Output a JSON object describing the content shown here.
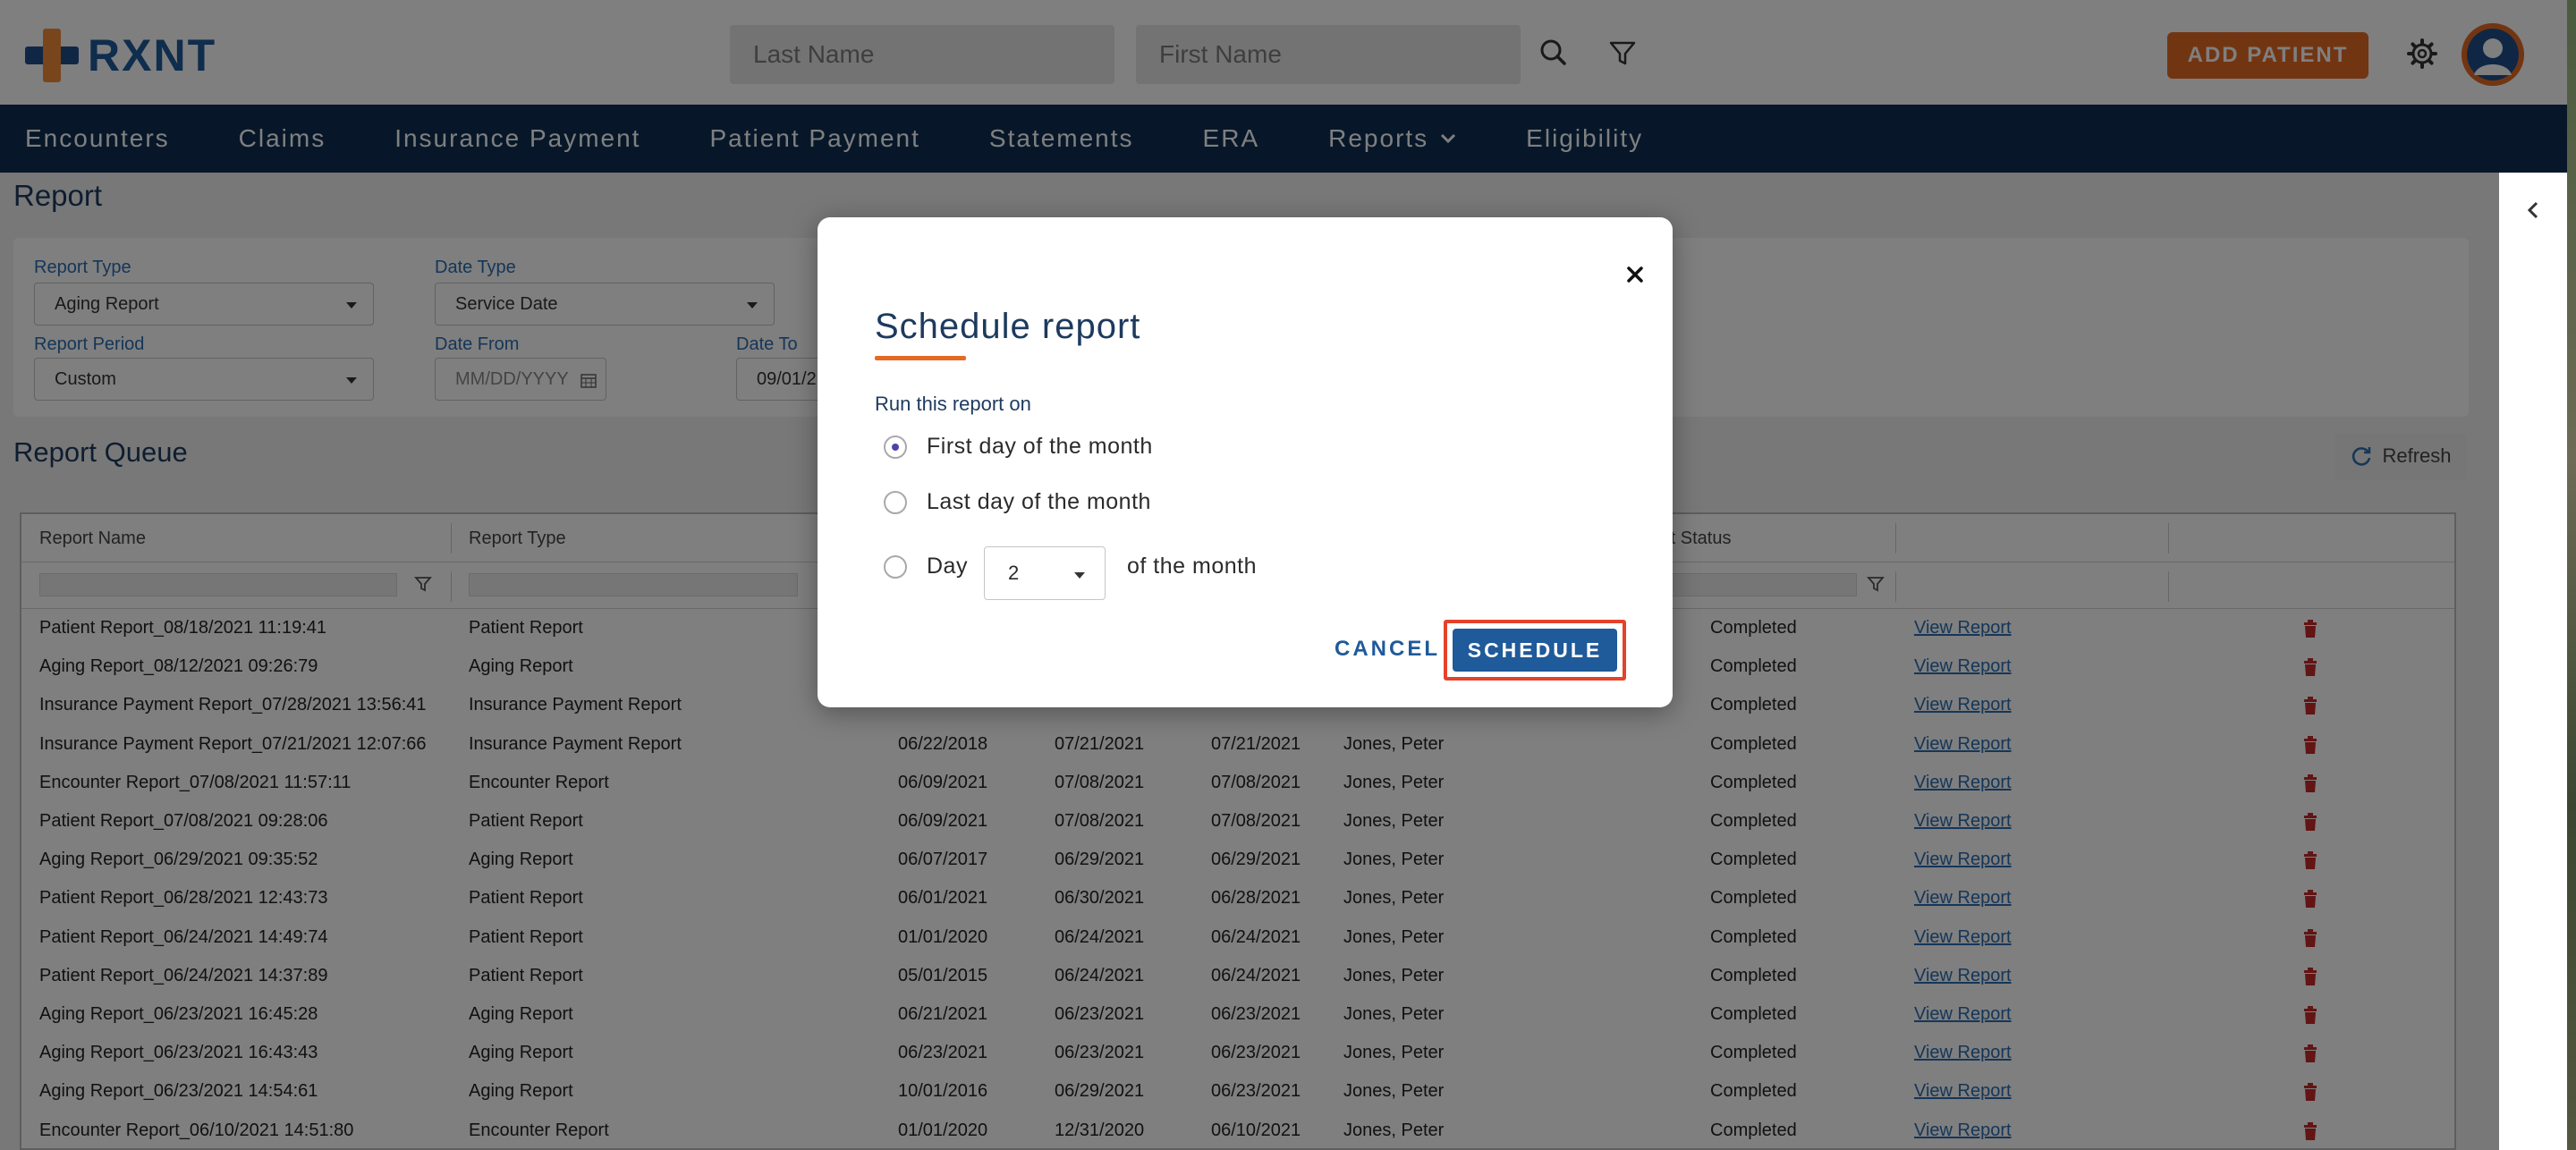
{
  "app": {
    "logo_text": "RXNT"
  },
  "header": {
    "last_name_placeholder": "Last Name",
    "first_name_placeholder": "First Name",
    "add_patient_label": "ADD PATIENT"
  },
  "nav": {
    "items": [
      {
        "label": "Encounters"
      },
      {
        "label": "Claims"
      },
      {
        "label": "Insurance Payment"
      },
      {
        "label": "Patient Payment"
      },
      {
        "label": "Statements"
      },
      {
        "label": "ERA"
      },
      {
        "label": "Reports"
      },
      {
        "label": "Eligibility"
      }
    ]
  },
  "page": {
    "title": "Report",
    "queue_title": "Report Queue",
    "refresh_label": "Refresh"
  },
  "filters": {
    "report_type_label": "Report Type",
    "report_type_value": "Aging Report",
    "date_type_label": "Date Type",
    "date_type_value": "Service Date",
    "report_period_label": "Report Period",
    "report_period_value": "Custom",
    "date_from_label": "Date From",
    "date_from_placeholder": "MM/DD/YYYY",
    "date_to_label": "Date To",
    "date_to_value": "09/01/2"
  },
  "table": {
    "headers": [
      "Report Name",
      "Report Type",
      "rt Status"
    ],
    "rows": [
      {
        "name": "Patient Report_08/18/2021 11:19:41",
        "type": "Patient Report",
        "d1": "",
        "d2": "",
        "d3": "",
        "user": "",
        "status": "Completed",
        "link": "View Report"
      },
      {
        "name": "Aging Report_08/12/2021 09:26:79",
        "type": "Aging Report",
        "d1": "",
        "d2": "",
        "d3": "",
        "user": "",
        "status": "Completed",
        "link": "View Report"
      },
      {
        "name": "Insurance Payment Report_07/28/2021 13:56:41",
        "type": "Insurance Payment Report",
        "d1": "",
        "d2": "",
        "d3": "",
        "user": "",
        "status": "Completed",
        "link": "View Report"
      },
      {
        "name": "Insurance Payment Report_07/21/2021 12:07:66",
        "type": "Insurance Payment Report",
        "d1": "06/22/2018",
        "d2": "07/21/2021",
        "d3": "07/21/2021",
        "user": "Jones, Peter",
        "status": "Completed",
        "link": "View Report"
      },
      {
        "name": "Encounter Report_07/08/2021 11:57:11",
        "type": "Encounter Report",
        "d1": "06/09/2021",
        "d2": "07/08/2021",
        "d3": "07/08/2021",
        "user": "Jones, Peter",
        "status": "Completed",
        "link": "View Report"
      },
      {
        "name": "Patient Report_07/08/2021 09:28:06",
        "type": "Patient Report",
        "d1": "06/09/2021",
        "d2": "07/08/2021",
        "d3": "07/08/2021",
        "user": "Jones, Peter",
        "status": "Completed",
        "link": "View Report"
      },
      {
        "name": "Aging Report_06/29/2021 09:35:52",
        "type": "Aging Report",
        "d1": "06/07/2017",
        "d2": "06/29/2021",
        "d3": "06/29/2021",
        "user": "Jones, Peter",
        "status": "Completed",
        "link": "View Report"
      },
      {
        "name": "Patient Report_06/28/2021 12:43:73",
        "type": "Patient Report",
        "d1": "06/01/2021",
        "d2": "06/30/2021",
        "d3": "06/28/2021",
        "user": "Jones, Peter",
        "status": "Completed",
        "link": "View Report"
      },
      {
        "name": "Patient Report_06/24/2021 14:49:74",
        "type": "Patient Report",
        "d1": "01/01/2020",
        "d2": "06/24/2021",
        "d3": "06/24/2021",
        "user": "Jones, Peter",
        "status": "Completed",
        "link": "View Report"
      },
      {
        "name": "Patient Report_06/24/2021 14:37:89",
        "type": "Patient Report",
        "d1": "05/01/2015",
        "d2": "06/24/2021",
        "d3": "06/24/2021",
        "user": "Jones, Peter",
        "status": "Completed",
        "link": "View Report"
      },
      {
        "name": "Aging Report_06/23/2021 16:45:28",
        "type": "Aging Report",
        "d1": "06/21/2021",
        "d2": "06/23/2021",
        "d3": "06/23/2021",
        "user": "Jones, Peter",
        "status": "Completed",
        "link": "View Report"
      },
      {
        "name": "Aging Report_06/23/2021 16:43:43",
        "type": "Aging Report",
        "d1": "06/23/2021",
        "d2": "06/23/2021",
        "d3": "06/23/2021",
        "user": "Jones, Peter",
        "status": "Completed",
        "link": "View Report"
      },
      {
        "name": "Aging Report_06/23/2021 14:54:61",
        "type": "Aging Report",
        "d1": "10/01/2016",
        "d2": "06/29/2021",
        "d3": "06/23/2021",
        "user": "Jones, Peter",
        "status": "Completed",
        "link": "View Report"
      },
      {
        "name": "Encounter Report_06/10/2021 14:51:80",
        "type": "Encounter Report",
        "d1": "01/01/2020",
        "d2": "12/31/2020",
        "d3": "06/10/2021",
        "user": "Jones, Peter",
        "status": "Completed",
        "link": "View Report"
      }
    ]
  },
  "modal": {
    "title": "Schedule report",
    "run_label": "Run this report on",
    "option_first": "First day of the month",
    "option_last": "Last day of the month",
    "option_day": "Day",
    "day_value": "2",
    "of_the_month": "of the month",
    "selected_option": "first",
    "cancel_label": "CANCEL",
    "schedule_label": "SCHEDULE"
  },
  "colors": {
    "brand_navy": "#0e2f53",
    "brand_orange": "#e46a24",
    "primary_blue": "#1f5a9a",
    "delete_red": "#c62828",
    "highlight_red": "#e4432b"
  },
  "icons": {
    "search": "search-icon",
    "filter": "funnel-icon",
    "settings": "gear-icon",
    "avatar": "user-avatar-icon",
    "close": "close-icon",
    "delete": "trash-icon",
    "refresh": "refresh-icon",
    "collapse": "chevron-left-icon"
  }
}
